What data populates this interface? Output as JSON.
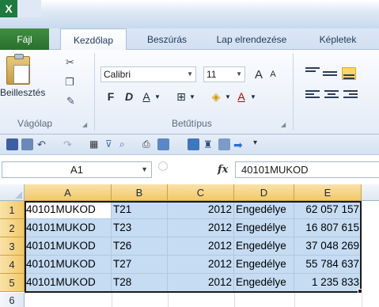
{
  "app": {
    "logo": "X"
  },
  "ribbon_tabs": [
    {
      "label": "Fájl",
      "state": "file"
    },
    {
      "label": "Kezdőlap",
      "state": "active"
    },
    {
      "label": "Beszúrás",
      "state": "normal"
    },
    {
      "label": "Lap elrendezése",
      "state": "normal"
    },
    {
      "label": "Képletek",
      "state": "normal"
    }
  ],
  "ribbon": {
    "paste_label": "Beillesztés",
    "clipboard_group": "Vágólap",
    "font_group": "Betűtípus",
    "font_name": "Calibri",
    "font_size": "11",
    "bold": "F",
    "italic": "D",
    "underline": "A",
    "grow_font": "A",
    "shrink_font": "A",
    "font_color_letter": "A"
  },
  "formula_bar": {
    "name_box": "A1",
    "fx_label": "fx",
    "content": "40101MUKOD"
  },
  "grid": {
    "columns": [
      "A",
      "B",
      "C",
      "D",
      "E"
    ],
    "rows": [
      {
        "num": "1",
        "a": "40101MUKOD",
        "b": "T21",
        "c": "2012",
        "d": "Engedélye",
        "e": "62 057 157"
      },
      {
        "num": "2",
        "a": "40101MUKOD",
        "b": "T23",
        "c": "2012",
        "d": "Engedélye",
        "e": "16 807 615"
      },
      {
        "num": "3",
        "a": "40101MUKOD",
        "b": "T26",
        "c": "2012",
        "d": "Engedélye",
        "e": "37 048 269"
      },
      {
        "num": "4",
        "a": "40101MUKOD",
        "b": "T27",
        "c": "2012",
        "d": "Engedélye",
        "e": "55 784 637"
      },
      {
        "num": "5",
        "a": "40101MUKOD",
        "b": "T28",
        "c": "2012",
        "d": "Engedélye",
        "e": "1 235 833"
      }
    ],
    "next_row": "6"
  },
  "colors": {
    "selection_fill": "#c5dcf3",
    "header_highlight": "#f2c967",
    "file_tab": "#2a6f2e"
  }
}
